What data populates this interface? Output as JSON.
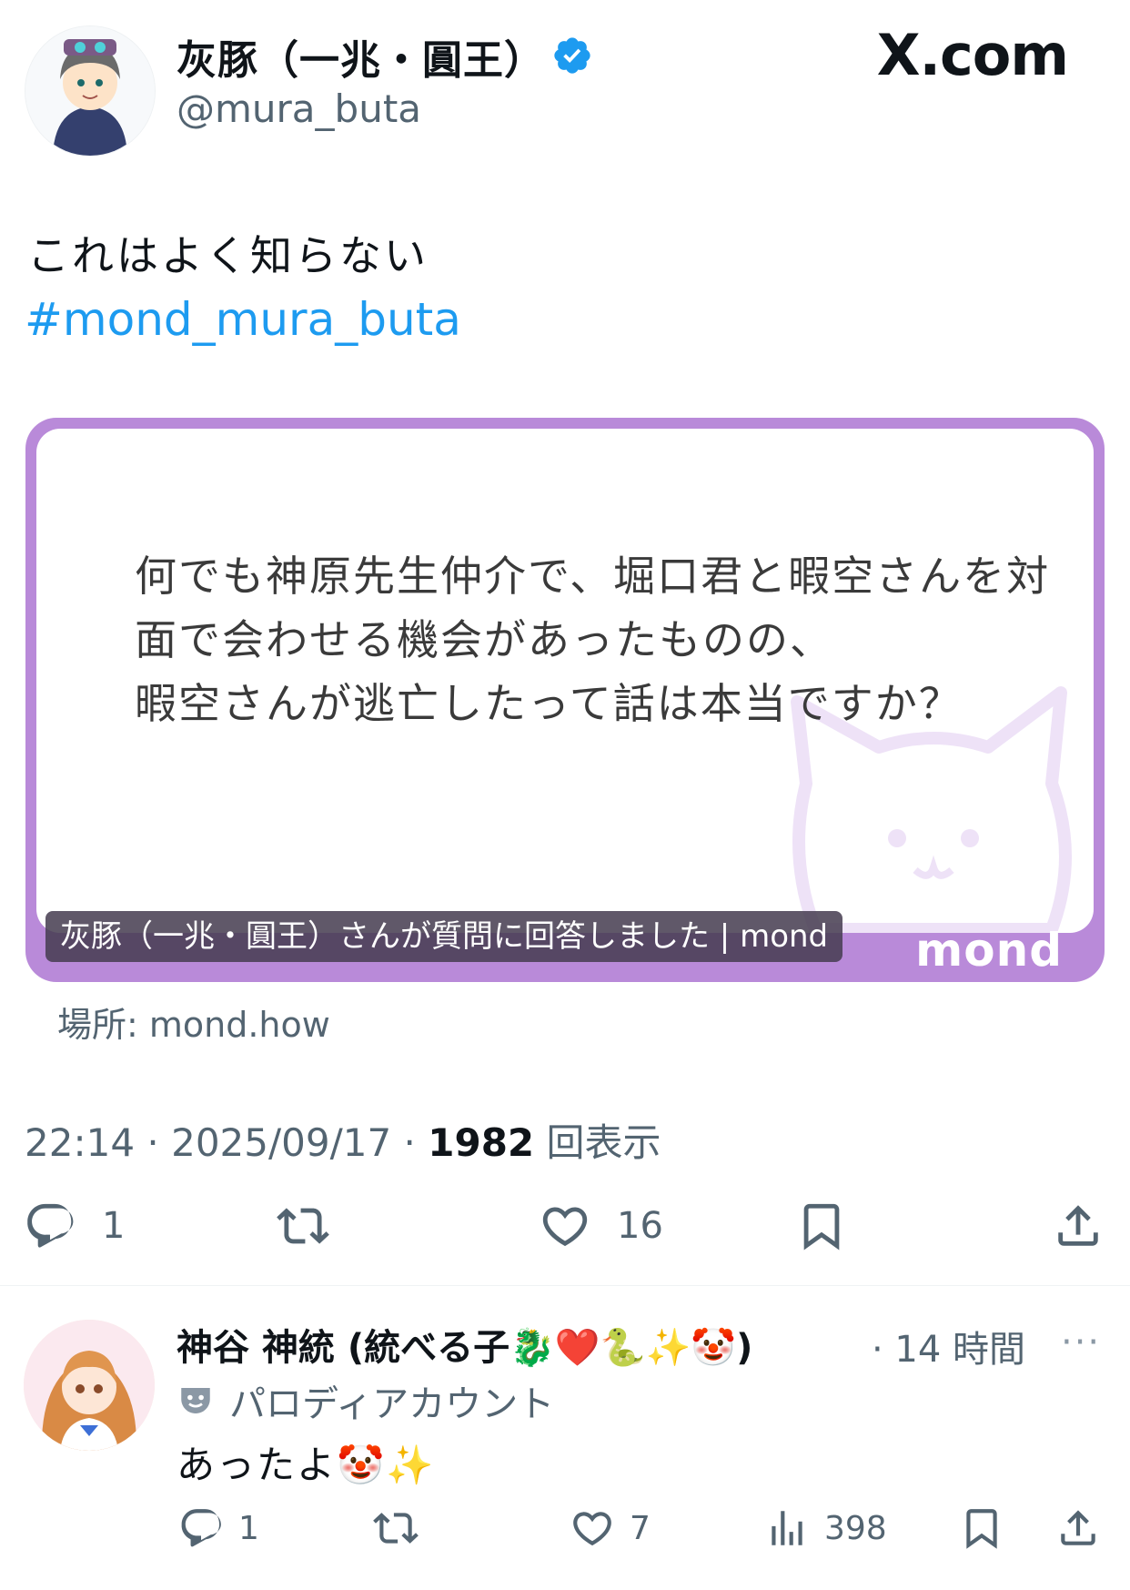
{
  "author": {
    "name": "灰豚（一兆・圓王）",
    "handle": "@mura_buta",
    "verified_icon": "verified-badge-icon"
  },
  "site_logo": "X.com",
  "tweet": {
    "text": "これはよく知らない",
    "hashtag": "#mond_mura_buta"
  },
  "card": {
    "question_lines": [
      "何でも神原先生仲介で、堀口君と暇空さんを対",
      "面で会わせる機会があったものの、",
      "暇空さんが逃亡したって話は本当ですか？"
    ],
    "caption": "灰豚（一兆・圓王）さんが質問に回答しました | mond",
    "logo": "mond",
    "colors": {
      "frame": "#b98ad9"
    }
  },
  "location": "場所: mond.how",
  "meta": {
    "time": "22:14",
    "date": "2025/09/17",
    "views": "1982",
    "views_label": "回表示"
  },
  "actions": {
    "replies": "1",
    "retweets": "",
    "likes": "16"
  },
  "reply": {
    "name": "神谷 神統 (統べる子🐉❤️🐍✨🤡)",
    "time": "· 14 時間",
    "more": "···",
    "account_label": "パロディアカウント",
    "text": "あったよ🤡✨",
    "actions": {
      "replies": "1",
      "retweets": "",
      "likes": "7",
      "views": "398"
    }
  },
  "colors": {
    "link": "#1d9bf0",
    "secondary_text": "#536471"
  }
}
